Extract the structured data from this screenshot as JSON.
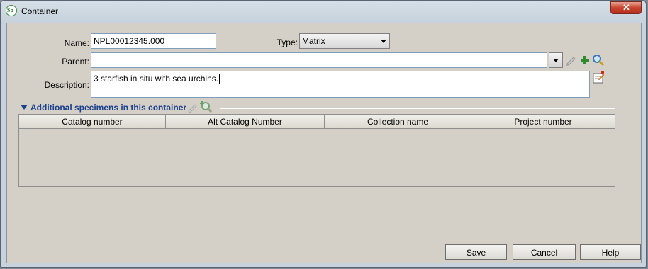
{
  "window": {
    "title": "Container",
    "app_icon_text": "Sp"
  },
  "form": {
    "name_label": "Name:",
    "name_value": "NPL00012345.000",
    "type_label": "Type:",
    "type_value": "Matrix",
    "parent_label": "Parent:",
    "parent_value": "",
    "description_label": "Description:",
    "description_value": "3 starfish in situ with sea urchins."
  },
  "section": {
    "title": "Additional specimens in this container"
  },
  "table": {
    "columns": [
      "Catalog number",
      "Alt Catalog Number",
      "Collection name",
      "Project number"
    ]
  },
  "buttons": {
    "save": "Save",
    "cancel": "Cancel",
    "help": "Help"
  },
  "colors": {
    "section_title": "#1a3f8c",
    "add_icon": "#2e8b2e"
  }
}
